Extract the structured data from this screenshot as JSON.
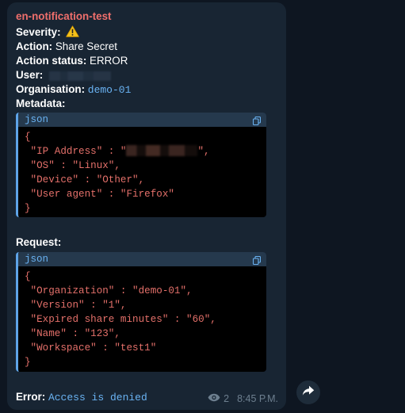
{
  "message": {
    "sender": "en-notification-test",
    "severity_label": "Severity:",
    "action_label": "Action:",
    "action_value": "Share Secret",
    "status_label": "Action status:",
    "status_value": "ERROR",
    "user_label": "User:",
    "org_label": "Organisation:",
    "org_value": "demo-01",
    "metadata_label": "Metadata:",
    "request_label": "Request:",
    "error_label": "Error:",
    "error_value": "Access is denied",
    "views": "2",
    "time": "8:45 P.M."
  },
  "metadata_block": {
    "lang": "json",
    "lines": [
      "{",
      " \"IP Address\" : \"",
      " \"OS\" : \"Linux\",",
      " \"Device\" : \"Other\",",
      " \"User agent\" : \"Firefox\"",
      "}"
    ],
    "ip_suffix": "\","
  },
  "request_block": {
    "lang": "json",
    "lines": [
      "{",
      " \"Organization\" : \"demo-01\",",
      " \"Version\" : \"1\",",
      " \"Expired share minutes\" : \"60\",",
      " \"Name\" : \"123\",",
      " \"Workspace\" : \"test1\"",
      "}"
    ]
  },
  "colors": {
    "background": "#0e1621",
    "bubble": "#182533",
    "sender": "#ef6f6c",
    "link": "#6ab3f3",
    "code_text": "#e4706a"
  }
}
